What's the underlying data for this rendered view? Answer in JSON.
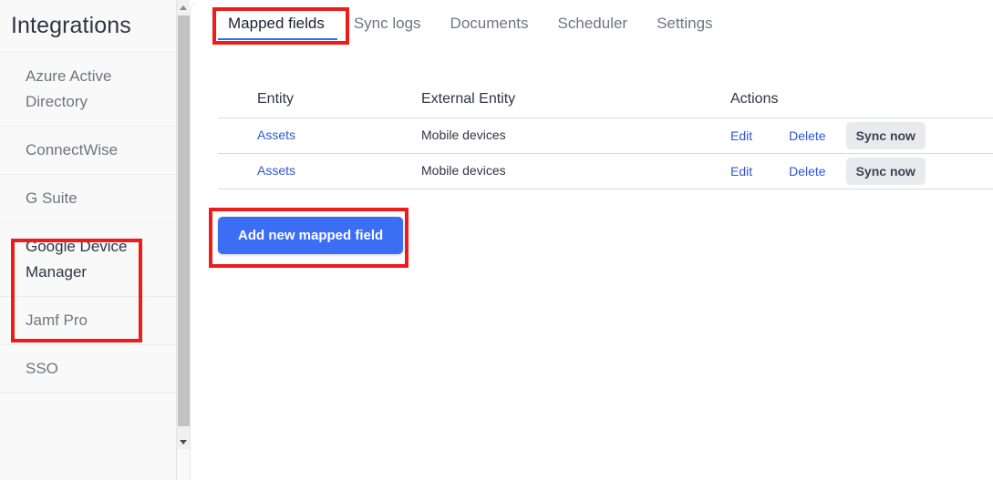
{
  "sidebar": {
    "title": "Integrations",
    "items": [
      {
        "label": "Azure Active Directory",
        "active": false
      },
      {
        "label": "ConnectWise",
        "active": false
      },
      {
        "label": "G Suite",
        "active": false
      },
      {
        "label": "Google Device Manager",
        "active": true
      },
      {
        "label": "Jamf Pro",
        "active": false
      },
      {
        "label": "SSO",
        "active": false
      }
    ],
    "scrollbar": {
      "up_icon": "triangle-up-icon",
      "down_icon": "triangle-down-icon"
    }
  },
  "tabs": [
    {
      "label": "Mapped fields",
      "active": true
    },
    {
      "label": "Sync logs",
      "active": false
    },
    {
      "label": "Documents",
      "active": false
    },
    {
      "label": "Scheduler",
      "active": false
    },
    {
      "label": "Settings",
      "active": false
    }
  ],
  "table": {
    "headers": [
      "Entity",
      "External Entity",
      "Actions"
    ],
    "rows": [
      {
        "entity": "Assets",
        "external_entity": "Mobile devices",
        "edit_label": "Edit",
        "delete_label": "Delete",
        "sync_label": "Sync now"
      },
      {
        "entity": "Assets",
        "external_entity": "Mobile devices",
        "edit_label": "Edit",
        "delete_label": "Delete",
        "sync_label": "Sync now"
      }
    ]
  },
  "primary_action": {
    "label": "Add new mapped field"
  },
  "colors": {
    "accent_blue": "#3b6ef5",
    "tab_underline": "#2f6df6",
    "link_blue": "#2f56d8",
    "annotation_red": "#ef1a1a",
    "sidebar_bg": "#f9f9f9",
    "sync_button_bg": "#e8eaed",
    "scrollbar_thumb": "#c2c2c2"
  }
}
